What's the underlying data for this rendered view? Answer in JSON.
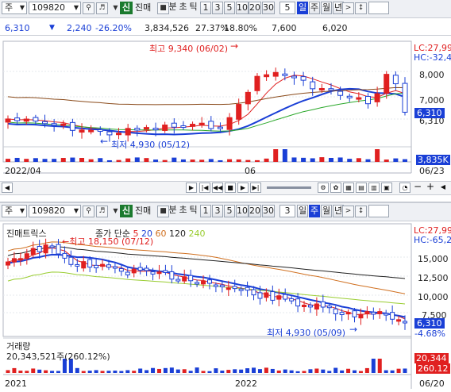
{
  "top": {
    "toolbar": {
      "market_label": "주",
      "code": "109820",
      "credit_label": "신",
      "jinmae_label": "진매",
      "timeframes": [
        "분",
        "초",
        "틱",
        "1",
        "3",
        "5",
        "10",
        "20",
        "30"
      ],
      "period_value": "5",
      "active_period": "일",
      "periods_after": [
        "주",
        "월",
        "년"
      ]
    },
    "quote": {
      "price": "6,310",
      "change": "2,240",
      "change_pct": "-26.20%",
      "volume": "3,834,526",
      "ratio1": "27.37%",
      "ratio2": "18.80%",
      "value1": "7,600",
      "value2": "6,020",
      "price_color": "#1a3fd6",
      "down_color": "#1a3fd6"
    },
    "chart": {
      "lc_label": "LC:27,99",
      "hc_label": "HC:-32,4",
      "y_ticks": [
        "8,000",
        "7,000",
        "6,310"
      ],
      "price_tag": "6,310",
      "volume_tag": "3,835K",
      "x_labels": [
        "2022/04",
        "06",
        "06/23"
      ],
      "annotation_high": "최고 9,340 (06/02)",
      "annotation_low": "최저 4,930 (05/12)",
      "up_color": "#e02020",
      "down_color": "#1a3fd6"
    }
  },
  "bottom": {
    "toolbar": {
      "market_label": "주",
      "code": "109820",
      "credit_label": "신",
      "jinmae_label": "진매",
      "timeframes": [
        "분",
        "초",
        "틱",
        "1",
        "3",
        "5",
        "10",
        "20",
        "30"
      ],
      "period_value": "3",
      "active_period": "주",
      "periods_before": [
        "일"
      ],
      "periods_after": [
        "월",
        "년"
      ]
    },
    "chart": {
      "title": "진매트릭스",
      "legend_prefix": "종가 단순",
      "ma_periods": [
        "5",
        "20",
        "60",
        "120",
        "240"
      ],
      "ma_colors": [
        "#e02020",
        "#1a3fd6",
        "#d07020",
        "#222222",
        "#9acd32"
      ],
      "lc_label": "LC:27,99",
      "hc_label": "HC:-65,2",
      "y_ticks": [
        "15,000",
        "12,500",
        "10,000",
        "7,500"
      ],
      "price_tag": "6,310",
      "pct_label": "-4.68%",
      "annotation_high": "최고 18,150 (07/12)",
      "annotation_low": "최저 4,930 (05/09)",
      "volume_title": "거래량",
      "volume_value": "20,343,521주(260.12%)",
      "volume_tag": "20,344",
      "volume_pct_tag": "260.12",
      "x_labels": [
        "2021",
        "2022",
        "06/20"
      ]
    }
  }
}
